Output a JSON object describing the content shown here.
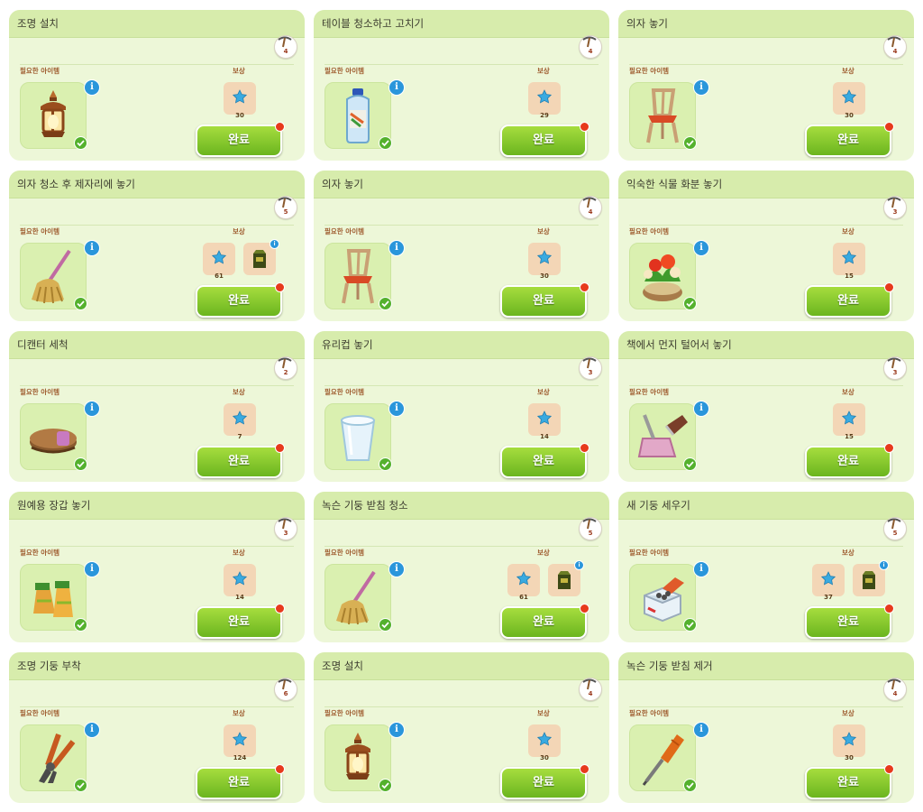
{
  "labels": {
    "required": "필요한 아이템",
    "reward": "보상",
    "complete": "완료",
    "info": "i"
  },
  "colors": {
    "card": "#edf7d8",
    "header": "#d7ecac",
    "button": "#7fc22a",
    "badge": "#e73a1c",
    "info": "#2a96db"
  },
  "tasks": [
    {
      "title": "조명 설치",
      "tool_count": "4",
      "item_icon": "lantern-icon",
      "rewards": [
        {
          "type": "star-icon",
          "value": "30"
        }
      ]
    },
    {
      "title": "테이블 청소하고 고치기",
      "tool_count": "4",
      "item_icon": "cleaner-bottle-icon",
      "rewards": [
        {
          "type": "star-icon",
          "value": "29"
        }
      ]
    },
    {
      "title": "의자 놓기",
      "tool_count": "4",
      "item_icon": "chair-icon",
      "rewards": [
        {
          "type": "star-icon",
          "value": "30"
        }
      ]
    },
    {
      "title": "의자 청소 후 제자리에 놓기",
      "tool_count": "5",
      "item_icon": "mop-icon",
      "rewards": [
        {
          "type": "star-icon",
          "value": "61"
        },
        {
          "type": "material-box-icon"
        }
      ]
    },
    {
      "title": "의자 놓기",
      "tool_count": "4",
      "item_icon": "chair-icon",
      "rewards": [
        {
          "type": "star-icon",
          "value": "30"
        }
      ]
    },
    {
      "title": "익숙한 식물 화분 놓기",
      "tool_count": "3",
      "item_icon": "flower-pot-icon",
      "rewards": [
        {
          "type": "star-icon",
          "value": "15"
        }
      ]
    },
    {
      "title": "디캔터 세척",
      "tool_count": "2",
      "item_icon": "brush-icon",
      "rewards": [
        {
          "type": "star-icon",
          "value": "7"
        }
      ]
    },
    {
      "title": "유리컵 놓기",
      "tool_count": "3",
      "item_icon": "glass-cup-icon",
      "rewards": [
        {
          "type": "star-icon",
          "value": "14"
        }
      ]
    },
    {
      "title": "책에서 먼지 털어서 놓기",
      "tool_count": "3",
      "item_icon": "dustpan-icon",
      "rewards": [
        {
          "type": "star-icon",
          "value": "15"
        }
      ]
    },
    {
      "title": "원예용 장갑 놓기",
      "tool_count": "3",
      "item_icon": "gloves-icon",
      "rewards": [
        {
          "type": "star-icon",
          "value": "14"
        }
      ]
    },
    {
      "title": "녹슨 기둥 받침 청소",
      "tool_count": "5",
      "item_icon": "mop-icon",
      "rewards": [
        {
          "type": "star-icon",
          "value": "61"
        },
        {
          "type": "material-box-icon"
        }
      ]
    },
    {
      "title": "새 기둥 세우기",
      "tool_count": "5",
      "item_icon": "nails-box-icon",
      "rewards": [
        {
          "type": "star-icon",
          "value": "37"
        },
        {
          "type": "material-box-icon"
        }
      ]
    },
    {
      "title": "조명 기둥 부착",
      "tool_count": "6",
      "item_icon": "pliers-icon",
      "rewards": [
        {
          "type": "star-icon",
          "value": "124"
        }
      ]
    },
    {
      "title": "조명 설치",
      "tool_count": "4",
      "item_icon": "lantern-icon",
      "rewards": [
        {
          "type": "star-icon",
          "value": "30"
        }
      ]
    },
    {
      "title": "녹슨 기둥 받침 제거",
      "tool_count": "4",
      "item_icon": "screwdriver-icon",
      "rewards": [
        {
          "type": "star-icon",
          "value": "30"
        }
      ]
    }
  ]
}
